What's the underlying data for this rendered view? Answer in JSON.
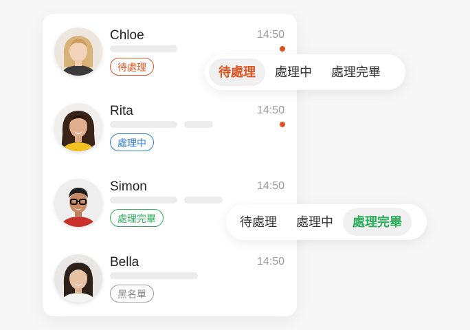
{
  "conversations": [
    {
      "name": "Chloe",
      "time": "14:50",
      "unread": true,
      "status": "待處理",
      "status_type": "pending"
    },
    {
      "name": "Rita",
      "time": "14:50",
      "unread": true,
      "status": "處理中",
      "status_type": "progress"
    },
    {
      "name": "Simon",
      "time": "14:50",
      "unread": false,
      "status": "處理完畢",
      "status_type": "done"
    },
    {
      "name": "Bella",
      "time": "14:50",
      "unread": false,
      "status": "黑名單",
      "status_type": "black"
    }
  ],
  "status_switcher_top": {
    "options": [
      "待處理",
      "處理中",
      "處理完畢"
    ],
    "selected": "待處理",
    "accent": "#e0531f"
  },
  "status_switcher_bottom": {
    "options": [
      "待處理",
      "處理中",
      "處理完畢"
    ],
    "selected": "處理完畢",
    "accent": "#2eae5b"
  },
  "colors": {
    "pending": "#e0531f",
    "progress": "#2f7fd0",
    "done": "#2eae5b",
    "blacklist": "#8a8a8a",
    "unread_dot": "#e0531f"
  },
  "icons": [
    "avatar-chloe",
    "avatar-rita",
    "avatar-simon",
    "avatar-bella"
  ]
}
